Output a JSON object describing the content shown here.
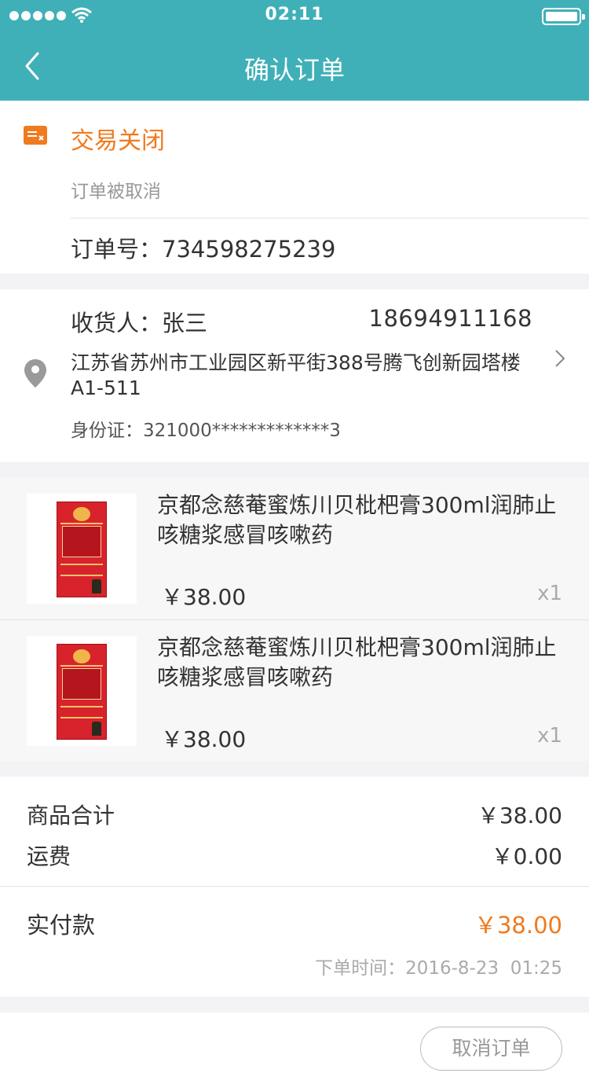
{
  "status_bar": {
    "time": "02:11"
  },
  "nav": {
    "title": "确认订单"
  },
  "order_status": {
    "title": "交易关闭",
    "subtitle": "订单被取消",
    "order_number_label": "订单号：",
    "order_number": "734598275239"
  },
  "address": {
    "receiver_label": "收货人：",
    "receiver_name": "张三",
    "phone": "18694911168",
    "full_address": "江苏省苏州市工业园区新平街388号腾飞创新园塔楼A1-511",
    "id_label": "身份证：",
    "id_number": "321000*************3"
  },
  "items": [
    {
      "title": "京都念慈菴蜜炼川贝枇杷膏300ml润肺止咳糖浆感冒咳嗽药",
      "price": "￥38.00",
      "qty": "x1"
    },
    {
      "title": "京都念慈菴蜜炼川贝枇杷膏300ml润肺止咳糖浆感冒咳嗽药",
      "price": "￥38.00",
      "qty": "x1"
    }
  ],
  "summary": {
    "goods_total_label": "商品合计",
    "goods_total": "￥38.00",
    "shipping_label": "运费",
    "shipping": "￥0.00",
    "paid_label": "实付款",
    "paid": "￥38.00",
    "order_time_label": "下单时间：",
    "order_time": "2016-8-23  01:25"
  },
  "actions": {
    "cancel_label": "取消订单"
  },
  "colors": {
    "header": "#3fb0b7",
    "accent": "#f07a1e"
  },
  "icons": [
    "back-icon",
    "order-closed-icon",
    "location-pin-icon",
    "chevron-right-icon"
  ]
}
